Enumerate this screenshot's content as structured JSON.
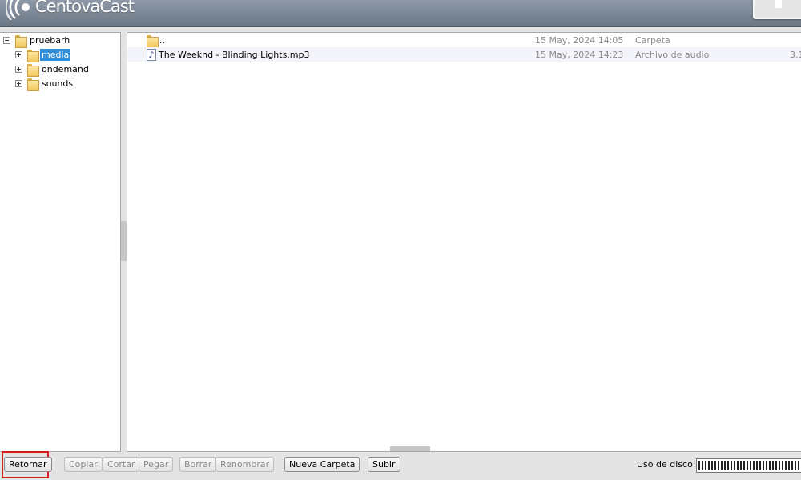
{
  "header": {
    "app_name": "CentovaCast",
    "logo_icon": "signal-waves-icon"
  },
  "tree": {
    "root": {
      "label": "pruebarh",
      "expander": "minus",
      "icon": "folder-icon"
    },
    "children": [
      {
        "label": "media",
        "expander": "plus",
        "icon": "folder-icon",
        "selected": true
      },
      {
        "label": "ondemand",
        "expander": "plus",
        "icon": "folder-icon",
        "selected": false
      },
      {
        "label": "sounds",
        "expander": "plus",
        "icon": "folder-icon",
        "selected": false
      }
    ]
  },
  "files": [
    {
      "name": "..",
      "date": "15 May, 2024 14:05",
      "type": "Carpeta",
      "size": "",
      "icon": "folder-icon"
    },
    {
      "name": "The Weeknd - Blinding Lights.mp3",
      "date": "15 May, 2024 14:23",
      "type": "Archivo de audio",
      "size": "3.1",
      "icon": "audio-file-icon"
    }
  ],
  "toolbar": {
    "return_label": "Retornar",
    "copy_label": "Copiar",
    "cut_label": "Cortar",
    "paste_label": "Pegar",
    "delete_label": "Borrar",
    "rename_label": "Renombrar",
    "new_folder_label": "Nueva Carpeta",
    "upload_label": "Subir",
    "disk_usage_label": "Uso de disco:"
  },
  "colors": {
    "header_bg": "#7b8594",
    "selection": "#2f8ed9",
    "highlight_box": "#d31d1d"
  }
}
